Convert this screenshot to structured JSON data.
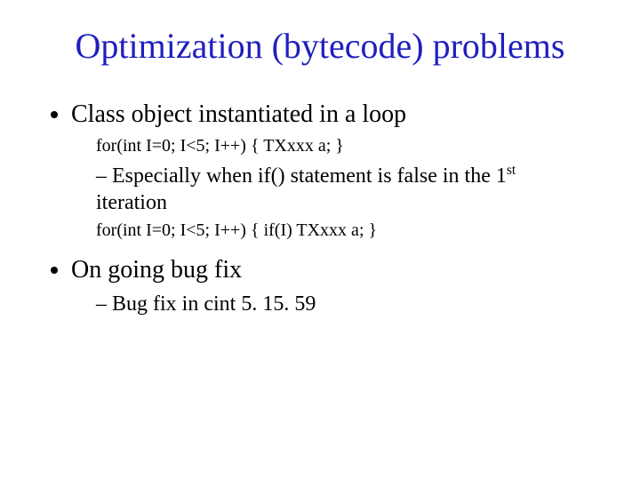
{
  "title": "Optimization (bytecode) problems",
  "bullets": {
    "b1": {
      "text": "Class object instantiated in a loop",
      "code1": "for(int I=0; I<5; I++) { TXxxx  a; }",
      "sub1_prefix": "Especially when if() statement is false in the 1",
      "sub1_sup": "st",
      "sub1_suffix": " iteration",
      "code2": "for(int I=0; I<5; I++) { if(I) TXxxx a; }"
    },
    "b2": {
      "text": "On going bug fix",
      "sub1": "Bug fix in cint 5. 15. 59"
    }
  }
}
